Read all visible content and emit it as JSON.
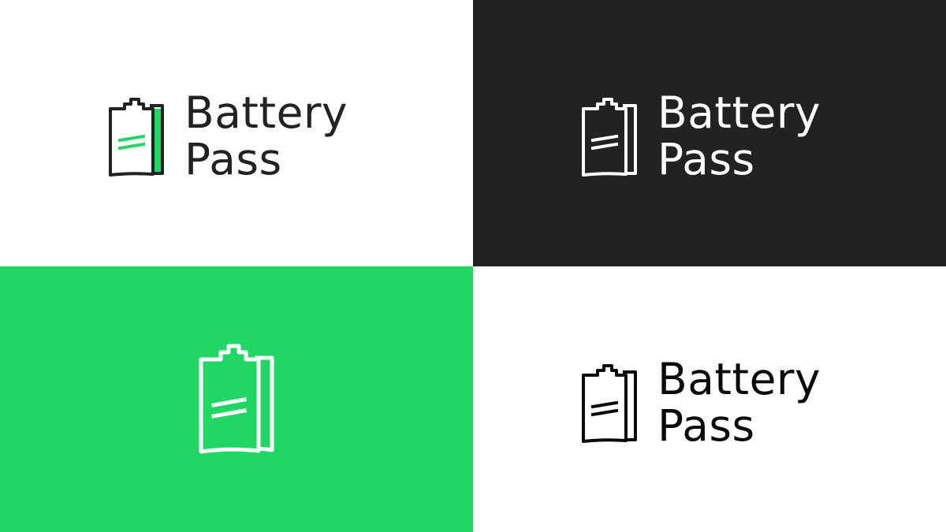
{
  "brand": {
    "line1": "Battery",
    "line2": "Pass"
  },
  "colors": {
    "accent_green": "#20d764",
    "dark_background": "#222222",
    "light_background": "#ffffff",
    "ink_dark": "#222222",
    "ink_black": "#0a0a0a",
    "ink_white": "#ffffff"
  },
  "variants": [
    {
      "id": "color-on-white",
      "icon": "battery-pass-logo-icon",
      "wordmark": true
    },
    {
      "id": "white-on-dark",
      "icon": "battery-pass-logo-icon",
      "wordmark": true
    },
    {
      "id": "white-on-green",
      "icon": "battery-pass-logo-icon",
      "wordmark": false
    },
    {
      "id": "black-on-white",
      "icon": "battery-pass-logo-icon",
      "wordmark": true
    }
  ]
}
